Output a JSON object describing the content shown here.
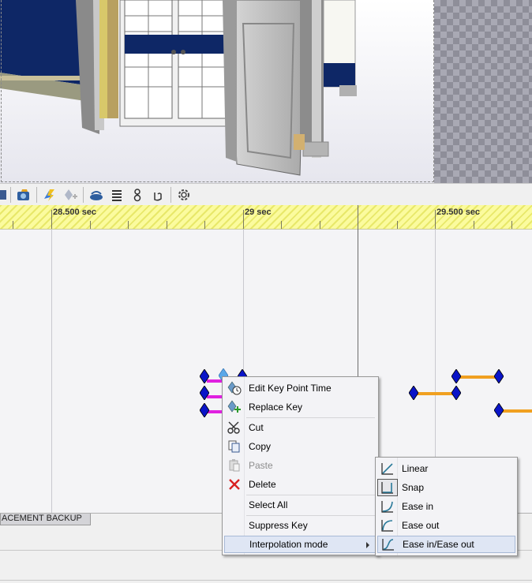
{
  "ruler": {
    "labels": [
      "28.500 sec",
      "29 sec",
      "29.500 sec"
    ]
  },
  "toolbar": {
    "icons": [
      "save-icon",
      "camera-icon",
      "rebuild-icon",
      "add-key-icon",
      "playback-icon",
      "stack-icon",
      "motion-icon",
      "cursor-icon",
      "settings-icon"
    ]
  },
  "bottom_tab": {
    "label": "ACEMENT BACKUP"
  },
  "context_menu": {
    "items": [
      {
        "label": "Edit Key Point Time",
        "icon": "edit-key-time-icon",
        "enabled": true
      },
      {
        "label": "Replace Key",
        "icon": "replace-key-icon",
        "enabled": true
      },
      {
        "label": "Cut",
        "icon": "scissors-icon",
        "enabled": true
      },
      {
        "label": "Copy",
        "icon": "copy-icon",
        "enabled": true
      },
      {
        "label": "Paste",
        "icon": "paste-icon",
        "enabled": false
      },
      {
        "label": "Delete",
        "icon": "delete-x-icon",
        "enabled": true
      },
      {
        "label": "Select All",
        "icon": "",
        "enabled": true
      },
      {
        "label": "Suppress Key",
        "icon": "",
        "enabled": true
      },
      {
        "label": "Interpolation mode",
        "icon": "",
        "enabled": true,
        "submenu": true
      }
    ]
  },
  "submenu": {
    "items": [
      {
        "label": "Linear",
        "icon": "linear-curve-icon"
      },
      {
        "label": "Snap",
        "icon": "snap-curve-icon"
      },
      {
        "label": "Ease in",
        "icon": "ease-in-curve-icon"
      },
      {
        "label": "Ease out",
        "icon": "ease-out-curve-icon"
      },
      {
        "label": "Ease in/Ease out",
        "icon": "ease-in-out-curve-icon",
        "highlighted": true
      }
    ]
  },
  "colors": {
    "key_diamond": "#0a14c8",
    "selected_key": "#5aa8e8",
    "bar_magenta": "#e020e0",
    "bar_orange": "#f0a020",
    "ruler_yellow": "#fbfb9e",
    "cursor_line": "#6d6d6d"
  }
}
